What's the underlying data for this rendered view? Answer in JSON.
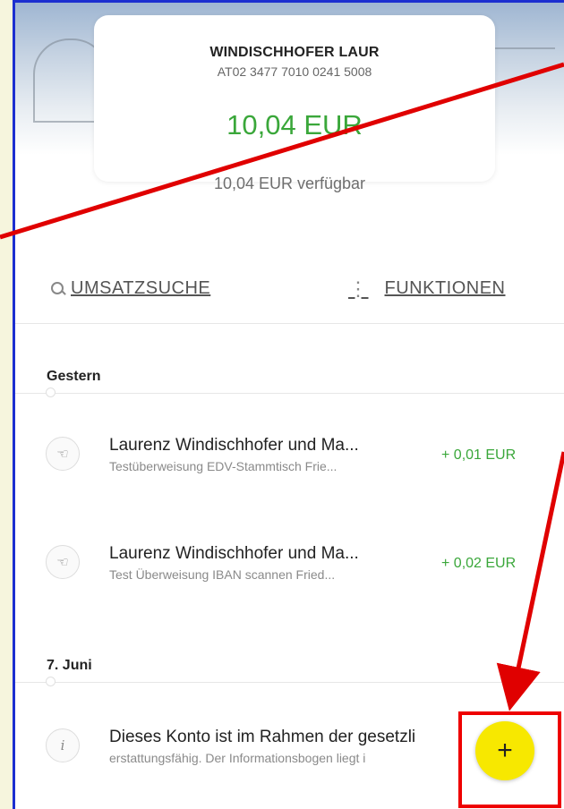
{
  "account": {
    "name": "WINDISCHHOFER LAUR",
    "iban": "AT02 3477 7010 0241 5008",
    "balance": "10,04 EUR",
    "available": "10,04 EUR verfügbar"
  },
  "actions": {
    "search_label": "UMSATZSUCHE",
    "functions_label": "FUNKTIONEN"
  },
  "sections": [
    {
      "label": "Gestern",
      "transactions": [
        {
          "icon": "hand-coin-icon",
          "title": "Laurenz Windischhofer und Ma...",
          "subtitle": "Testüberweisung EDV-Stammtisch Frie...",
          "amount": "+ 0,01 EUR"
        },
        {
          "icon": "hand-coin-icon",
          "title": "Laurenz Windischhofer und Ma...",
          "subtitle": "Test Überweisung IBAN scannen Fried...",
          "amount": "+ 0,02 EUR"
        }
      ]
    },
    {
      "label": "7. Juni",
      "transactions": [
        {
          "icon": "info-icon",
          "title": "Dieses Konto ist im Rahmen der gesetzli",
          "subtitle": "erstattungsfähig. Der Informationsbogen liegt i"
        }
      ]
    }
  ],
  "fab": {
    "label": "+"
  },
  "colors": {
    "accent_green": "#3aa73a",
    "fab_yellow": "#f7e800",
    "annotation_red": "#e00000",
    "frame_blue": "#1c2fd0"
  }
}
